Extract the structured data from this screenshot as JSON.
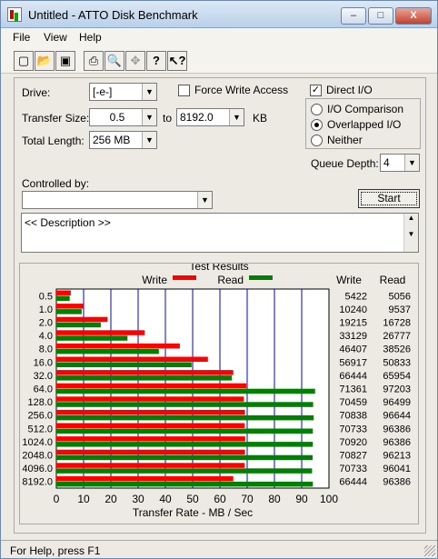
{
  "window": {
    "title": "Untitled - ATTO Disk Benchmark",
    "minimize_label": "–",
    "maximize_label": "□",
    "close_label": "X"
  },
  "menu": {
    "file": "File",
    "view": "View",
    "help": "Help"
  },
  "toolbar": {
    "icons": [
      "new-icon",
      "open-icon",
      "save-icon",
      "print-icon",
      "print-preview-icon",
      "move-icon",
      "help-icon",
      "context-help-icon"
    ]
  },
  "settings": {
    "drive_label": "Drive:",
    "drive_value": "[-e-]",
    "force_write_access": "Force Write Access",
    "direct_io": "Direct I/O",
    "direct_io_checked": true,
    "transfer_size_label": "Transfer Size:",
    "transfer_from": "0.5",
    "to_label": "to",
    "transfer_to": "8192.0",
    "kb_label": "KB",
    "total_length_label": "Total Length:",
    "total_length_value": "256 MB",
    "io_comparison": "I/O Comparison",
    "overlapped_io": "Overlapped I/O",
    "neither": "Neither",
    "queue_depth_label": "Queue Depth:",
    "queue_depth_value": "4",
    "controlled_by_label": "Controlled by:",
    "controlled_by_value": "",
    "start_label": "Start",
    "description": "<< Description >>"
  },
  "chart_data": {
    "type": "bar",
    "title": "Test Results",
    "xlabel": "Transfer Rate - MB / Sec",
    "xlim": [
      0,
      100
    ],
    "xticks": [
      "0",
      "10",
      "20",
      "30",
      "40",
      "50",
      "60",
      "70",
      "80",
      "90",
      "100"
    ],
    "categories": [
      "0.5",
      "1.0",
      "2.0",
      "4.0",
      "8.0",
      "16.0",
      "32.0",
      "64.0",
      "128.0",
      "256.0",
      "512.0",
      "1024.0",
      "2048.0",
      "4096.0",
      "8192.0"
    ],
    "series": [
      {
        "name": "Write",
        "color": "#ff0000",
        "values": [
          5.3,
          10.0,
          18.8,
          32.4,
          45.3,
          55.6,
          64.9,
          69.7,
          68.8,
          69.2,
          69.1,
          69.3,
          69.2,
          69.1,
          64.9
        ]
      },
      {
        "name": "Read",
        "color": "#008000",
        "values": [
          4.9,
          9.3,
          16.3,
          26.1,
          37.6,
          49.6,
          64.4,
          94.9,
          94.2,
          94.4,
          94.1,
          94.1,
          94.0,
          93.8,
          94.1
        ]
      }
    ],
    "write_header": "Write",
    "read_header": "Read",
    "write_values": [
      "5422",
      "10240",
      "19215",
      "33129",
      "46407",
      "56917",
      "66444",
      "71361",
      "70459",
      "70838",
      "70733",
      "70920",
      "70827",
      "70733",
      "66444"
    ],
    "read_values": [
      "5056",
      "9537",
      "16728",
      "26777",
      "38526",
      "50833",
      "65954",
      "97203",
      "96499",
      "96644",
      "96386",
      "96386",
      "96213",
      "96041",
      "96386"
    ]
  },
  "status": {
    "text": "For Help, press F1"
  }
}
